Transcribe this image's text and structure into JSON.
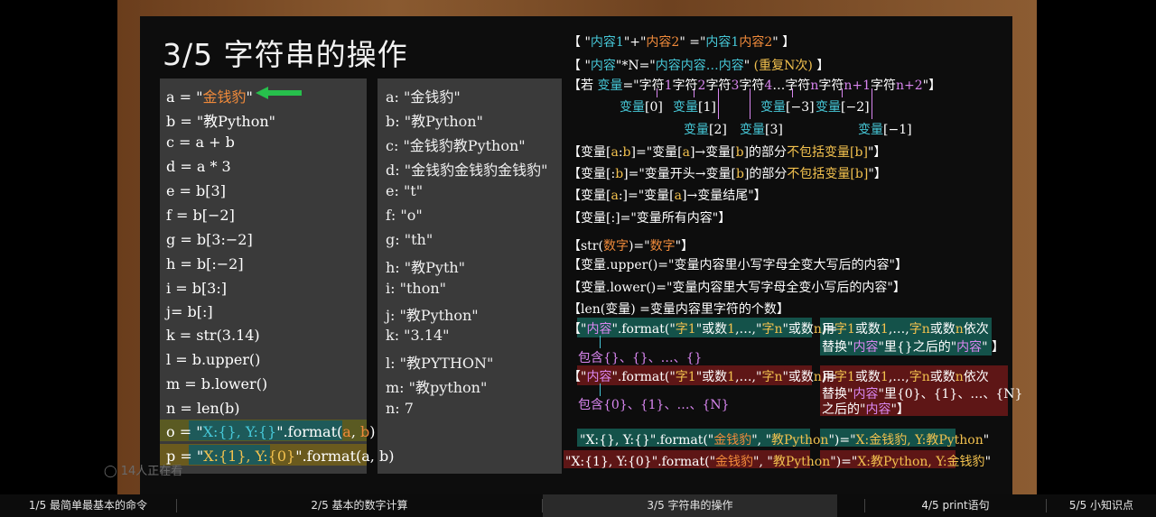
{
  "title": "3/5 字符串的操作",
  "code": [
    {
      "parts": [
        [
          "a = \"",
          "w"
        ],
        [
          "金钱豹",
          "o"
        ],
        [
          "\"",
          "w"
        ]
      ]
    },
    {
      "parts": [
        [
          "b = \"教Python\"",
          "w"
        ]
      ]
    },
    {
      "parts": [
        [
          "c = a + b",
          "w"
        ]
      ]
    },
    {
      "parts": [
        [
          "d = a * 3",
          "w"
        ]
      ]
    },
    {
      "parts": [
        [
          "e = b[3]",
          "w"
        ]
      ]
    },
    {
      "parts": [
        [
          "f = b[−2]",
          "w"
        ]
      ]
    },
    {
      "parts": [
        [
          "g = b[3:−2]",
          "w"
        ]
      ]
    },
    {
      "parts": [
        [
          "h = b[:−2]",
          "w"
        ]
      ]
    },
    {
      "parts": [
        [
          "i = b[3:]",
          "w"
        ]
      ]
    },
    {
      "parts": [
        [
          "j= b[:]",
          "w"
        ]
      ]
    },
    {
      "parts": [
        [
          "k = str(3.14)",
          "w"
        ]
      ]
    },
    {
      "parts": [
        [
          "l = b.upper()",
          "w"
        ]
      ]
    },
    {
      "parts": [
        [
          "m = b.lower()",
          "w"
        ]
      ]
    },
    {
      "parts": [
        [
          "n = len(b)",
          "w"
        ]
      ]
    },
    {
      "parts": [
        [
          "o = \"",
          "w"
        ],
        [
          "X:{}, Y:{}",
          "c"
        ],
        [
          "\".format(",
          "w"
        ],
        [
          "a",
          "o"
        ],
        [
          ", ",
          "w"
        ],
        [
          "b",
          "o"
        ],
        [
          ")",
          "w"
        ]
      ]
    },
    {
      "parts": [
        [
          "p = \"",
          "w"
        ],
        [
          "X:{1}, Y:{0}",
          "y"
        ],
        [
          "\".format(a, b)",
          "w"
        ]
      ]
    }
  ],
  "outputs": [
    "a: \"金钱豹\"",
    "b: \"教Python\"",
    "c: \"金钱豹教Python\"",
    "d: \"金钱豹金钱豹金钱豹\"",
    "e: \"t\"",
    "f: \"o\"",
    "g: \"th\"",
    "h: \"教Pyth\"",
    "i: \"thon\"",
    "j: \"教Python\"",
    "k: \"3.14\"",
    "l: \"教PYTHON\"",
    "m: \"教python\"",
    "n: 7"
  ],
  "rules": {
    "concat": [
      [
        "【 \"",
        "w"
      ],
      [
        "内容",
        "c"
      ],
      [
        "1",
        "c"
      ],
      [
        "\"+\"",
        "w"
      ],
      [
        "内容",
        "o"
      ],
      [
        "2",
        "o"
      ],
      [
        "\" =\"",
        "w"
      ],
      [
        "内容",
        "c"
      ],
      [
        "1",
        "c"
      ],
      [
        "内容",
        "o"
      ],
      [
        "2",
        "o"
      ],
      [
        "\" 】",
        "w"
      ]
    ],
    "repeat": [
      [
        "【 \"",
        "w"
      ],
      [
        "内容",
        "c"
      ],
      [
        "\"*N=\"",
        "w"
      ],
      [
        "内容内容…内容",
        "c"
      ],
      [
        "\" ",
        "w"
      ],
      [
        "(重复N次)",
        "y"
      ],
      [
        " 】",
        "w"
      ]
    ],
    "index_header": [
      [
        "【若 ",
        "w"
      ],
      [
        "变量",
        "c"
      ],
      [
        "=\"字符",
        "w"
      ],
      [
        "1",
        "p"
      ],
      [
        "字符",
        "w"
      ],
      [
        "2",
        "p"
      ],
      [
        "字符",
        "w"
      ],
      [
        "3",
        "p"
      ],
      [
        "字符",
        "w"
      ],
      [
        "4",
        "p"
      ],
      [
        "…字符",
        "w"
      ],
      [
        "n",
        "p"
      ],
      [
        "字符",
        "w"
      ],
      [
        "n+1",
        "p"
      ],
      [
        "字符",
        "w"
      ],
      [
        "n+2",
        "p"
      ],
      [
        "\"】",
        "w"
      ]
    ],
    "idx_labels": [
      [
        [
          "变量",
          "c"
        ],
        [
          "[0]",
          "w"
        ]
      ],
      [
        [
          "变量",
          "c"
        ],
        [
          "[1]",
          "w"
        ]
      ],
      [
        [
          "变量",
          "c"
        ],
        [
          "[2]",
          "w"
        ]
      ],
      [
        [
          "变量",
          "c"
        ],
        [
          "[3]",
          "w"
        ]
      ],
      [
        [
          "变量",
          "c"
        ],
        [
          "[−3]",
          "w"
        ]
      ],
      [
        [
          "变量",
          "c"
        ],
        [
          "[−2]",
          "w"
        ]
      ],
      [
        [
          "变量",
          "c"
        ],
        [
          "[−1]",
          "w"
        ]
      ]
    ],
    "slice_ab": [
      [
        "【变量[",
        "w"
      ],
      [
        "a",
        "y"
      ],
      [
        ":",
        "w"
      ],
      [
        "b",
        "y"
      ],
      [
        "]=\"变量[",
        "w"
      ],
      [
        "a",
        "y"
      ],
      [
        "]→变量[",
        "w"
      ],
      [
        "b",
        "y"
      ],
      [
        "]的部分",
        "w"
      ],
      [
        "不包括变量[b]",
        "y"
      ],
      [
        "\"】",
        "w"
      ]
    ],
    "slice_b": [
      [
        "【变量[:",
        "w"
      ],
      [
        "b",
        "y"
      ],
      [
        "]=\"变量开头→变量[",
        "w"
      ],
      [
        "b",
        "y"
      ],
      [
        "]的部分",
        "w"
      ],
      [
        "不包括变量[b]",
        "y"
      ],
      [
        "\"】",
        "w"
      ]
    ],
    "slice_a": [
      [
        "【变量[",
        "w"
      ],
      [
        "a",
        "y"
      ],
      [
        ":]=\"变量[",
        "w"
      ],
      [
        "a",
        "y"
      ],
      [
        "]→变量结尾\"】",
        "w"
      ]
    ],
    "slice_all": [
      [
        "【变量[:]=\"变量所有内容\"】",
        "w"
      ]
    ],
    "str": [
      [
        "【str(",
        "w"
      ],
      [
        "数字",
        "o"
      ],
      [
        ")=\"",
        "w"
      ],
      [
        "数字",
        "o"
      ],
      [
        "\"】",
        "w"
      ]
    ],
    "upper": [
      [
        "【变量.upper()=\"变量内容里小写字母全变大写后的内容\"】",
        "w"
      ]
    ],
    "lower": [
      [
        "【变量.lower()=\"变量内容里大写字母全变小写后的内容\"】",
        "w"
      ]
    ],
    "len": [
      [
        "【len(变量) =变量内容里字符的个数】",
        "w"
      ]
    ],
    "fmt1_left": [
      [
        "【\"",
        "w"
      ],
      [
        "内容",
        "p"
      ],
      [
        "\".format(\"",
        "w"
      ],
      [
        "字",
        "y"
      ],
      [
        "1",
        "y"
      ],
      [
        "\"或数",
        "w"
      ],
      [
        "1",
        "y"
      ],
      [
        ",…,\"",
        "w"
      ],
      [
        "字",
        "y"
      ],
      [
        "n",
        "y"
      ],
      [
        "\"或数",
        "w"
      ],
      [
        "n",
        "y"
      ],
      [
        ")=",
        "w"
      ]
    ],
    "fmt1_right_a": [
      [
        "用",
        "w"
      ],
      [
        "字",
        "y"
      ],
      [
        "1",
        "y"
      ],
      [
        "或数",
        "w"
      ],
      [
        "1",
        "y"
      ],
      [
        ",…,",
        "w"
      ],
      [
        "字",
        "y"
      ],
      [
        "n",
        "y"
      ],
      [
        "或数",
        "w"
      ],
      [
        "n",
        "y"
      ],
      [
        "依次",
        "w"
      ]
    ],
    "fmt1_right_b": [
      [
        "替换\"",
        "w"
      ],
      [
        "内容",
        "p"
      ],
      [
        "\"里{}之后的\"",
        "w"
      ],
      [
        "内容",
        "p"
      ],
      [
        "\" 】",
        "w"
      ]
    ],
    "fmt1_contains": [
      [
        "包含{}、{}、…、{}",
        "p"
      ]
    ],
    "fmt2_left": [
      [
        "【\"",
        "w"
      ],
      [
        "内容",
        "p"
      ],
      [
        "\".format(\"",
        "w"
      ],
      [
        "字",
        "y"
      ],
      [
        "1",
        "y"
      ],
      [
        "\"或数",
        "w"
      ],
      [
        "1",
        "y"
      ],
      [
        ",…,\"",
        "w"
      ],
      [
        "字",
        "y"
      ],
      [
        "n",
        "y"
      ],
      [
        "\"或数",
        "w"
      ],
      [
        "n",
        "y"
      ],
      [
        ")=",
        "w"
      ]
    ],
    "fmt2_right_a": [
      [
        "用",
        "w"
      ],
      [
        "字",
        "y"
      ],
      [
        "1",
        "y"
      ],
      [
        "或数",
        "w"
      ],
      [
        "1",
        "y"
      ],
      [
        ",…,",
        "w"
      ],
      [
        "字",
        "y"
      ],
      [
        "n",
        "y"
      ],
      [
        "或数",
        "w"
      ],
      [
        "n",
        "y"
      ],
      [
        "依次",
        "w"
      ]
    ],
    "fmt2_right_b": [
      [
        "替换\"",
        "w"
      ],
      [
        "内容",
        "p"
      ],
      [
        "\"里{0}、{1}、…、{N}",
        "w"
      ]
    ],
    "fmt2_right_c": [
      [
        "之后的\"",
        "w"
      ],
      [
        "内容",
        "p"
      ],
      [
        "\"",
        "w"
      ],
      [
        "】",
        "w"
      ]
    ],
    "fmt2_contains": [
      [
        "包含{0}、{1}、…、{N}",
        "p"
      ]
    ],
    "ex1": [
      [
        "\"X:{}, Y:{}\".format(\"",
        "w"
      ],
      [
        "金钱豹",
        "o"
      ],
      [
        "\", \"",
        "w"
      ],
      [
        "教Python",
        "y"
      ],
      [
        "\")=\"",
        "w"
      ],
      [
        "X:金钱豹, Y:教Python",
        "y"
      ],
      [
        "\"",
        "w"
      ]
    ],
    "ex2": [
      [
        "\"X:{1}, Y:{0}\".format(\"",
        "w"
      ],
      [
        "金钱豹",
        "o"
      ],
      [
        "\", \"",
        "w"
      ],
      [
        "教Python",
        "y"
      ],
      [
        "\")=\"",
        "w"
      ],
      [
        "X:教Python, Y:金钱豹",
        "y"
      ],
      [
        "\"",
        "w"
      ]
    ]
  },
  "viewers": "14人正在看",
  "tabs": [
    {
      "label": "1/5 最简单最基本的命令",
      "active": false
    },
    {
      "label": "2/5 基本的数字计算",
      "active": false
    },
    {
      "label": "3/5 字符串的操作",
      "active": true
    },
    {
      "label": "4/5 print语句",
      "active": false
    },
    {
      "label": "5/5 小知识点",
      "active": false
    }
  ],
  "colors": {
    "orange": "#f08a3a",
    "cyan": "#46c8d8",
    "purple": "#d986f0",
    "yellow": "#f2c14e",
    "arrow": "#27c04c"
  }
}
